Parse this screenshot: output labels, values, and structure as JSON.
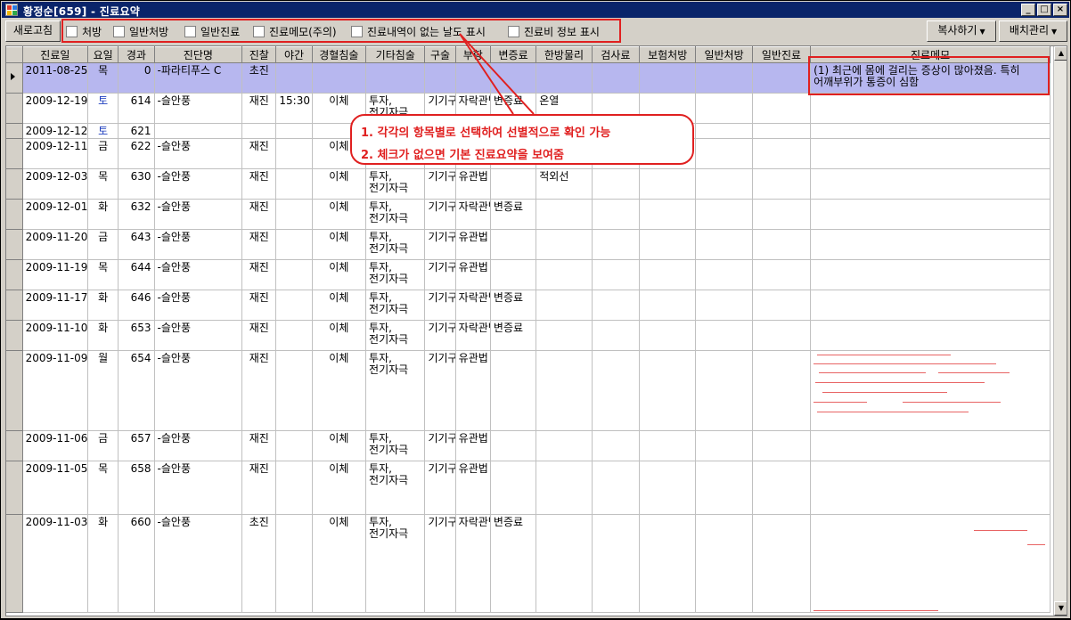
{
  "window": {
    "title": "황정순[659] - 진료요약"
  },
  "toolbar": {
    "refresh_label": "새로고침",
    "filters": [
      {
        "label": "처방"
      },
      {
        "label": "일반처방"
      },
      {
        "label": "일반진료"
      },
      {
        "label": "진료메모(주의)"
      },
      {
        "label": "진료내역이 없는 날도 표시"
      },
      {
        "label": "진료비 정보 표시"
      }
    ],
    "copy_label": "복사하기",
    "batch_label": "배치관리"
  },
  "grid": {
    "columns": [
      "진료일",
      "요일",
      "경과",
      "진단명",
      "진찰",
      "야간",
      "경혈침술",
      "기타침술",
      "구술",
      "부항",
      "변증료",
      "한방물리",
      "검사료",
      "보험처방",
      "일반처방",
      "일반진료",
      "진료메모"
    ],
    "rows": [
      {
        "date": "2011-08-25",
        "day": "목",
        "elapsed": "0",
        "diagnosis": "-파라티푸스 C",
        "exam": "초진",
        "night": "",
        "acu": "",
        "other": "",
        "oral": "",
        "cupping": "",
        "pattern": "",
        "physio": "",
        "test": "",
        "ins_rx": "",
        "gen_rx": "",
        "gen_care": "",
        "memo": "(1) 최근에 몸에 걸리는 증상이 많아졌음. 특히 어깨부위가 통증이 심함"
      },
      {
        "date": "2009-12-19",
        "day": "토",
        "elapsed": "614",
        "diagnosis": "-슬안풍",
        "exam": "재진",
        "night": "15:30",
        "acu": "이체",
        "other": "투자,전기자극",
        "oral": "기기구술",
        "cupping": "자락관법",
        "pattern": "변증료",
        "physio": "온열",
        "test": "",
        "ins_rx": "",
        "gen_rx": "",
        "gen_care": "",
        "memo": ""
      },
      {
        "date": "2009-12-12",
        "day": "토",
        "elapsed": "621",
        "diagnosis": "",
        "exam": "",
        "night": "",
        "acu": "",
        "other": "",
        "oral": "",
        "cupping": "",
        "pattern": "",
        "physio": "",
        "test": "",
        "ins_rx": "",
        "gen_rx": "",
        "gen_care": "",
        "memo": ""
      },
      {
        "date": "2009-12-11",
        "day": "금",
        "elapsed": "622",
        "diagnosis": "-슬안풍",
        "exam": "재진",
        "night": "",
        "acu": "이체",
        "other": "",
        "oral": "",
        "cupping": "",
        "pattern": "",
        "physio": "",
        "test": "",
        "ins_rx": "",
        "gen_rx": "",
        "gen_care": "",
        "memo": ""
      },
      {
        "date": "2009-12-03",
        "day": "목",
        "elapsed": "630",
        "diagnosis": "-슬안풍",
        "exam": "재진",
        "night": "",
        "acu": "이체",
        "other": "투자,전기자극",
        "oral": "기기구술",
        "cupping": "유관법",
        "pattern": "",
        "physio": "적외선",
        "test": "",
        "ins_rx": "",
        "gen_rx": "",
        "gen_care": "",
        "memo": ""
      },
      {
        "date": "2009-12-01",
        "day": "화",
        "elapsed": "632",
        "diagnosis": "-슬안풍",
        "exam": "재진",
        "night": "",
        "acu": "이체",
        "other": "투자,전기자극",
        "oral": "기기구술",
        "cupping": "자락관법",
        "pattern": "변증료",
        "physio": "",
        "test": "",
        "ins_rx": "",
        "gen_rx": "",
        "gen_care": "",
        "memo": ""
      },
      {
        "date": "2009-11-20",
        "day": "금",
        "elapsed": "643",
        "diagnosis": "-슬안풍",
        "exam": "재진",
        "night": "",
        "acu": "이체",
        "other": "투자,전기자극",
        "oral": "기기구술",
        "cupping": "유관법",
        "pattern": "",
        "physio": "",
        "test": "",
        "ins_rx": "",
        "gen_rx": "",
        "gen_care": "",
        "memo": ""
      },
      {
        "date": "2009-11-19",
        "day": "목",
        "elapsed": "644",
        "diagnosis": "-슬안풍",
        "exam": "재진",
        "night": "",
        "acu": "이체",
        "other": "투자,전기자극",
        "oral": "기기구술",
        "cupping": "유관법",
        "pattern": "",
        "physio": "",
        "test": "",
        "ins_rx": "",
        "gen_rx": "",
        "gen_care": "",
        "memo": ""
      },
      {
        "date": "2009-11-17",
        "day": "화",
        "elapsed": "646",
        "diagnosis": "-슬안풍",
        "exam": "재진",
        "night": "",
        "acu": "이체",
        "other": "투자,전기자극",
        "oral": "기기구술",
        "cupping": "자락관법",
        "pattern": "변증료",
        "physio": "",
        "test": "",
        "ins_rx": "",
        "gen_rx": "",
        "gen_care": "",
        "memo": ""
      },
      {
        "date": "2009-11-10",
        "day": "화",
        "elapsed": "653",
        "diagnosis": "-슬안풍",
        "exam": "재진",
        "night": "",
        "acu": "이체",
        "other": "투자,전기자극",
        "oral": "기기구술",
        "cupping": "자락관법",
        "pattern": "변증료",
        "physio": "",
        "test": "",
        "ins_rx": "",
        "gen_rx": "",
        "gen_care": "",
        "memo": ""
      },
      {
        "date": "2009-11-09",
        "day": "월",
        "elapsed": "654",
        "diagnosis": "-슬안풍",
        "exam": "재진",
        "night": "",
        "acu": "이체",
        "other": "투자,전기자극",
        "oral": "기기구술",
        "cupping": "유관법",
        "pattern": "",
        "physio": "",
        "test": "",
        "ins_rx": "",
        "gen_rx": "",
        "gen_care": "",
        "memo": ""
      },
      {
        "date": "2009-11-06",
        "day": "금",
        "elapsed": "657",
        "diagnosis": "-슬안풍",
        "exam": "재진",
        "night": "",
        "acu": "이체",
        "other": "투자,전기자극",
        "oral": "기기구술",
        "cupping": "유관법",
        "pattern": "",
        "physio": "",
        "test": "",
        "ins_rx": "",
        "gen_rx": "",
        "gen_care": "",
        "memo": ""
      },
      {
        "date": "2009-11-05",
        "day": "목",
        "elapsed": "658",
        "diagnosis": "-슬안풍",
        "exam": "재진",
        "night": "",
        "acu": "이체",
        "other": "투자,전기자극",
        "oral": "기기구술",
        "cupping": "유관법",
        "pattern": "",
        "physio": "",
        "test": "",
        "ins_rx": "",
        "gen_rx": "",
        "gen_care": "",
        "memo": ""
      },
      {
        "date": "2009-11-03",
        "day": "화",
        "elapsed": "660",
        "diagnosis": "-슬안풍",
        "exam": "초진",
        "night": "",
        "acu": "이체",
        "other": "투자,전기자극",
        "oral": "기기구술",
        "cupping": "자락관법",
        "pattern": "변증료",
        "physio": "",
        "test": "",
        "ins_rx": "",
        "gen_rx": "",
        "gen_care": "",
        "memo": ""
      }
    ]
  },
  "annotations": {
    "line1": "1. 각각의 항목별로 선택하여 선별적으로 확인 가능",
    "line2": "2. 체크가 없으면 기본 진료요약을 보여줌"
  },
  "colors": {
    "selected_row": "#b7b7ef",
    "saturday_text": "#1f3fbf",
    "annotation_red": "#e02020",
    "titlebar": "#0a246a"
  }
}
